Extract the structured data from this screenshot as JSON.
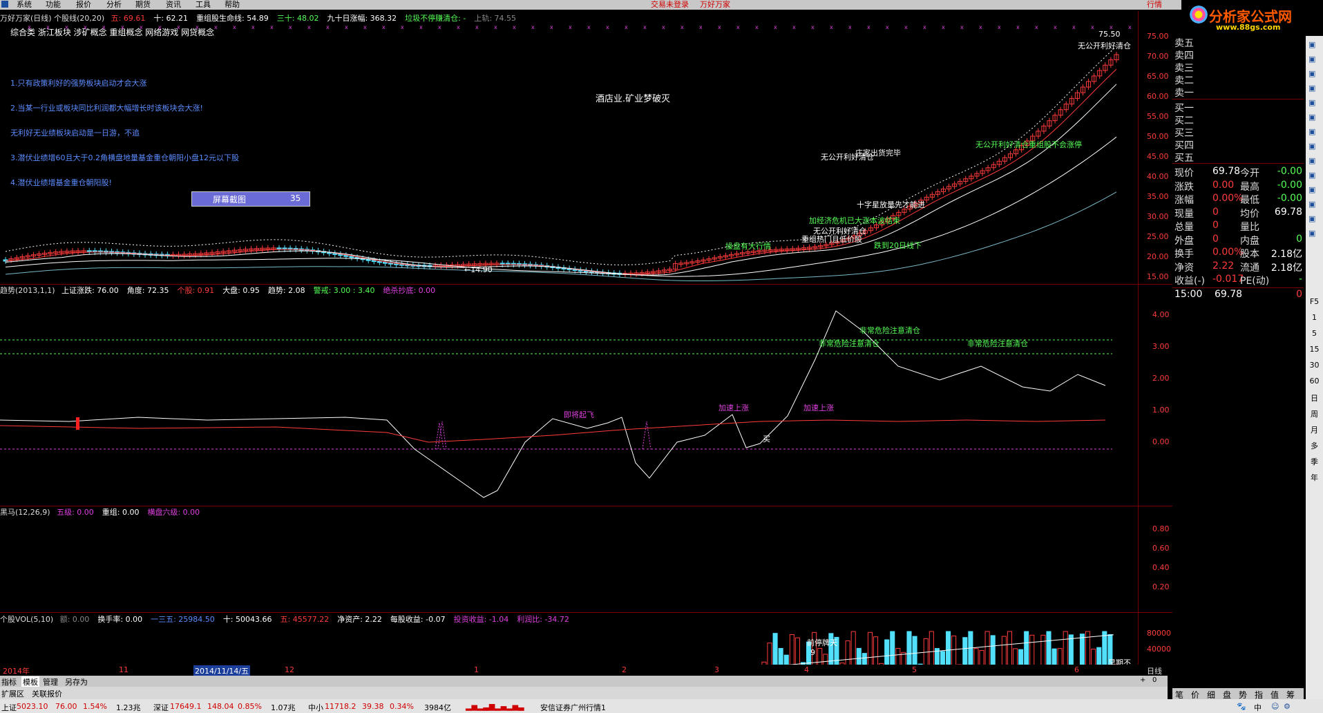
{
  "menubar": {
    "items": [
      "系统",
      "功能",
      "报价",
      "分析",
      "期货",
      "资讯",
      "工具",
      "帮助"
    ],
    "status_left": "交易未登录",
    "status_right": "万好万家",
    "right_tab": "行情"
  },
  "logo": {
    "text": "分析家公式网",
    "url": "www.88gs.com"
  },
  "main_title": {
    "name": "万好万家(日线) 个股线(20,20)",
    "items": [
      {
        "label": "五: 69.61",
        "color": "#ff3b3b"
      },
      {
        "label": "十: 62.21",
        "color": "#ffffff"
      },
      {
        "label": "重组股生命线: 54.89",
        "color": "#ffffff"
      },
      {
        "label": "三十: 48.02",
        "color": "#55ff55"
      },
      {
        "label": "九十日涨幅: 368.32",
        "color": "#ffffff"
      },
      {
        "label": "垃圾不停赚清仓: -",
        "color": "#55ff55"
      },
      {
        "label": "上轨: 74.55",
        "color": "#888888"
      }
    ]
  },
  "concepts": "综合类 浙江板块 涉矿概念 重组概念 网络游戏 网贷概念",
  "notes": [
    "1.只有政策利好的强势板块启动才会大涨",
    "2.当某一行业或板块同比利润都大幅增长时该板块会大涨!",
    "无利好无业绩板块启动是一日游，不追",
    "3.潜伏业绩增60且大于0.2角横盘地量基金重仓朝阳小盘12元以下股",
    "4.潜伏业绩增基金重仓朝阳股!"
  ],
  "screenshot_button": {
    "label": "屏幕截图",
    "value": "35"
  },
  "center_note": "酒店业.矿业梦破灭",
  "price_axis": [
    "75.00",
    "70.00",
    "65.00",
    "60.00",
    "55.00",
    "50.00",
    "45.00",
    "40.00",
    "35.00",
    "30.00",
    "25.00",
    "20.00",
    "15.00"
  ],
  "price_labels": {
    "high": "75.50",
    "low": "←14.90"
  },
  "chart_annotations": [
    {
      "text": "无公开利好清仓",
      "color": "#ffffff"
    },
    {
      "text": "庄家出货完毕",
      "color": "#ffffff"
    },
    {
      "text": "无公开利好清仓重组股不会涨停",
      "color": "#55ff55"
    },
    {
      "text": "十字星放量先才能进",
      "color": "#ffffff"
    },
    {
      "text": "加经济危机已大涨本波结束",
      "color": "#55ff55"
    },
    {
      "text": "无公开利好清仓",
      "color": "#ffffff"
    },
    {
      "text": "重组热门且低价股",
      "color": "#ffffff"
    },
    {
      "text": "操盘有大行情",
      "color": "#55ff55"
    },
    {
      "text": "跌到20日线下",
      "color": "#55ff55"
    },
    {
      "text": "无公开利好清仓",
      "color": "#ffffff"
    }
  ],
  "trend_panel": {
    "title": "趋势(2013,1,1)",
    "items": [
      {
        "label": "上证涨跌: 76.00",
        "color": "#ffffff"
      },
      {
        "label": "角度: 72.35",
        "color": "#ffffff"
      },
      {
        "label": "个股: 0.91",
        "color": "#ff3b3b"
      },
      {
        "label": "大盘: 0.95",
        "color": "#ffffff"
      },
      {
        "label": "趋势: 2.08",
        "color": "#ffffff"
      },
      {
        "label": "警戒: 3.00 : 3.40",
        "color": "#55ff55"
      },
      {
        "label": "绝杀抄底: 0.00",
        "color": "#e040e0"
      }
    ],
    "axis": [
      "4.00",
      "3.00",
      "2.00",
      "1.00",
      "0.00"
    ],
    "annotations": [
      {
        "text": "非常危险注意清仓",
        "color": "#55ff55"
      },
      {
        "text": "非常危险注意清仓",
        "color": "#55ff55"
      },
      {
        "text": "非常危险注意清仓",
        "color": "#55ff55"
      },
      {
        "text": "加速上涨",
        "color": "#e040e0"
      },
      {
        "text": "加速上涨",
        "color": "#e040e0"
      },
      {
        "text": "即将起飞",
        "color": "#e040e0"
      },
      {
        "text": "买",
        "color": "#ffffff"
      }
    ]
  },
  "horse_panel": {
    "title": "黑马(12,26,9)",
    "items": [
      {
        "label": "五级: 0.00",
        "color": "#e040e0"
      },
      {
        "label": "重组: 0.00",
        "color": "#ffffff"
      },
      {
        "label": "横盘六级: 0.00",
        "color": "#e040e0"
      }
    ],
    "axis": [
      "0.80",
      "0.60",
      "0.40",
      "0.20"
    ]
  },
  "vol_panel": {
    "title": "个股VOL(5,10)",
    "items": [
      {
        "label": "额: 0.00",
        "color": "#888888"
      },
      {
        "label": "换手率: 0.00",
        "color": "#ffffff"
      },
      {
        "label": "一三五: 25984.50",
        "color": "#5b8cff"
      },
      {
        "label": "十: 50043.66",
        "color": "#ffffff"
      },
      {
        "label": "五: 45577.22",
        "color": "#ff3b3b"
      },
      {
        "label": "净资产: 2.22",
        "color": "#ffffff"
      },
      {
        "label": "每股收益: -0.07",
        "color": "#ffffff"
      },
      {
        "label": "投资收益: -1.04",
        "color": "#e040e0"
      },
      {
        "label": "利润比: -34.72",
        "color": "#e040e0"
      }
    ],
    "axis": [
      "80000",
      "40000"
    ],
    "annotation": "前停牌天",
    "annotation2": "9",
    "annotation3": "早期不"
  },
  "timeline": {
    "labels": [
      "2014年",
      "11",
      "2014/11/14/五",
      "12",
      "1",
      "2",
      "3",
      "4",
      "5",
      "6"
    ],
    "period": "日线"
  },
  "tabs": [
    "指标",
    "模板",
    "管理",
    "另存为"
  ],
  "tabs2": [
    "扩展区",
    "关联报价"
  ],
  "quote": {
    "sells": [
      "卖五",
      "卖四",
      "卖三",
      "卖二",
      "卖一"
    ],
    "buys": [
      "买一",
      "买二",
      "买三",
      "买四",
      "买五"
    ],
    "rows": [
      {
        "l": "现价",
        "v": "69.78",
        "r": "今开",
        "v2": "-0.00"
      },
      {
        "l": "涨跌",
        "v": "0.00",
        "r": "最高",
        "v2": "-0.00"
      },
      {
        "l": "涨幅",
        "v": "0.00%",
        "r": "最低",
        "v2": "-0.00"
      },
      {
        "l": "现量",
        "v": "0",
        "r": "均价",
        "v2": "69.78"
      },
      {
        "l": "总量",
        "v": "0",
        "r": "量比",
        "v2": ""
      },
      {
        "l": "外盘",
        "v": "0",
        "r": "内盘",
        "v2": "0"
      },
      {
        "l": "换手",
        "v": "0.00%",
        "r": "股本",
        "v2": "2.18亿"
      },
      {
        "l": "净资",
        "v": "2.22",
        "r": "流通",
        "v2": "2.18亿"
      },
      {
        "l": "收益(-)",
        "v": "-0.017",
        "r": "PE(动)",
        "v2": "-"
      }
    ],
    "tick": {
      "time": "15:00",
      "price": "69.78",
      "vol": "0"
    },
    "bottom_tabs": [
      "笔",
      "价",
      "细",
      "盘",
      "势",
      "指",
      "值",
      "筹"
    ]
  },
  "sidebar_items": [
    "F5",
    "1",
    "5",
    "15",
    "30",
    "60",
    "日",
    "周",
    "月",
    "多",
    "季",
    "年"
  ],
  "statusbar": {
    "sh": {
      "name": "上证",
      "value": "5023.10",
      "chg": "76.00",
      "pct": "1.54%",
      "amt": "1.23兆"
    },
    "sz": {
      "name": "深证",
      "value": "17649.1",
      "chg": "148.04",
      "pct": "0.85%",
      "amt": "1.07兆"
    },
    "zx": {
      "name": "中小",
      "value": "11718.2",
      "chg": "39.38",
      "pct": "0.34%",
      "amt": "3984亿"
    },
    "broker": "安信证券广州行情1",
    "ime": [
      "中"
    ]
  }
}
